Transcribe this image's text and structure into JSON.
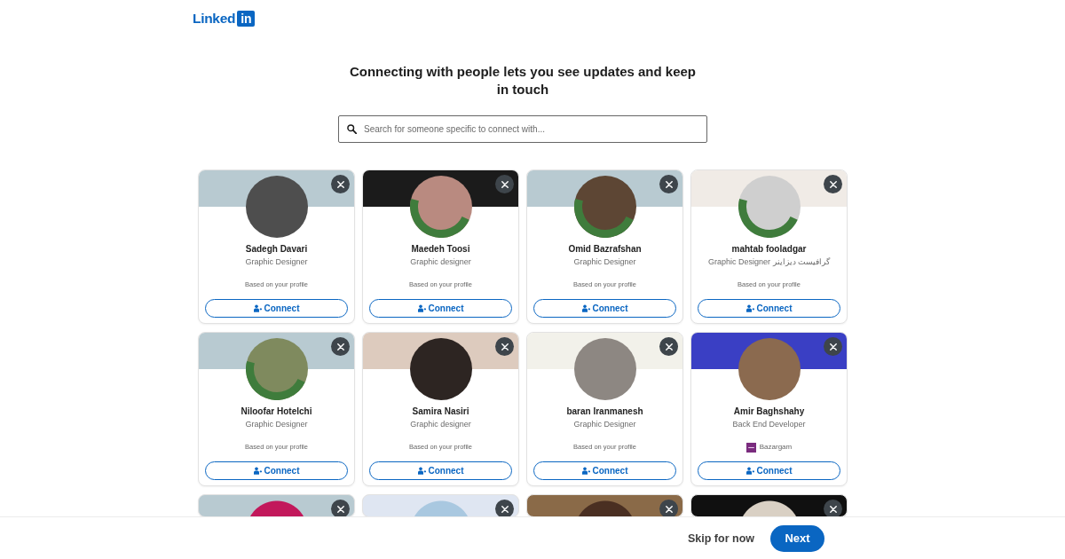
{
  "header": {
    "logo": {
      "wordmark": "Linked",
      "badge": "in"
    }
  },
  "prompt": {
    "title": "Connecting with people lets you see updates and keep in touch"
  },
  "search": {
    "placeholder": "Search for someone specific to connect with..."
  },
  "cards": [
    {
      "name": "Sadegh Davari",
      "headline": "Graphic Designer",
      "context": {
        "kind": "reason",
        "text": "Based on your profile"
      },
      "open_to_work": false,
      "banner": {
        "kind": "plain"
      },
      "action": "Connect"
    },
    {
      "name": "Maedeh Toosi",
      "headline": "Graphic designer",
      "context": {
        "kind": "reason",
        "text": "Based on your profile"
      },
      "open_to_work": true,
      "banner": {
        "kind": "photo"
      },
      "action": "Connect"
    },
    {
      "name": "Omid Bazrafshan",
      "headline": "Graphic Designer",
      "context": {
        "kind": "reason",
        "text": "Based on your profile"
      },
      "open_to_work": true,
      "banner": {
        "kind": "plain"
      },
      "action": "Connect"
    },
    {
      "name": "mahtab fooladgar",
      "headline": "Graphic Designer گرافیست دیزاینر",
      "context": {
        "kind": "reason",
        "text": "Based on your profile"
      },
      "open_to_work": true,
      "banner": {
        "kind": "photo"
      },
      "action": "Connect"
    },
    {
      "name": "Niloofar Hotelchi",
      "headline": "Graphic Designer",
      "context": {
        "kind": "reason",
        "text": "Based on your profile"
      },
      "open_to_work": true,
      "banner": {
        "kind": "plain"
      },
      "action": "Connect"
    },
    {
      "name": "Samira Nasiri",
      "headline": "Graphic designer",
      "context": {
        "kind": "reason",
        "text": "Based on your profile"
      },
      "open_to_work": false,
      "banner": {
        "kind": "photo"
      },
      "action": "Connect"
    },
    {
      "name": "baran Iranmanesh",
      "headline": "Graphic Designer",
      "context": {
        "kind": "reason",
        "text": "Based on your profile"
      },
      "open_to_work": false,
      "banner": {
        "kind": "photo"
      },
      "action": "Connect"
    },
    {
      "name": "Amir Baghshahy",
      "headline": "Back End Developer",
      "context": {
        "kind": "company",
        "text": "Bazargam"
      },
      "open_to_work": false,
      "banner": {
        "kind": "photo"
      },
      "action": "Connect"
    },
    {
      "banner": {
        "kind": "plain"
      }
    },
    {
      "banner": {
        "kind": "photo"
      }
    },
    {
      "banner": {
        "kind": "photo"
      }
    },
    {
      "banner": {
        "kind": "photo"
      }
    }
  ],
  "footer": {
    "skip": "Skip for now",
    "next": "Next"
  }
}
